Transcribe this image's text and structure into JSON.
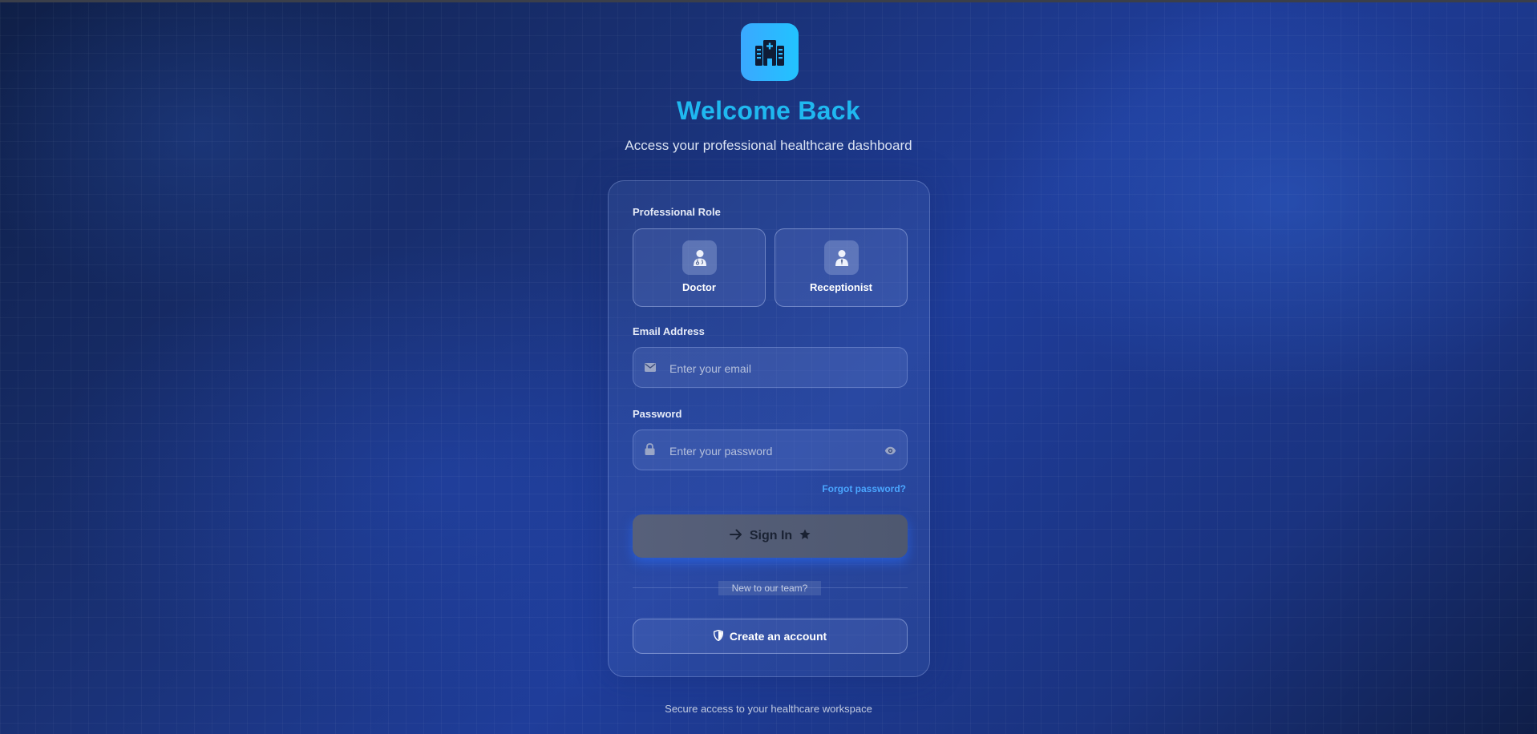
{
  "header": {
    "logo_icon": "hospital-icon",
    "title": "Welcome Back",
    "subtitle": "Access your professional healthcare dashboard"
  },
  "form": {
    "role_label": "Professional Role",
    "roles": [
      {
        "label": "Doctor",
        "icon": "doctor-icon"
      },
      {
        "label": "Receptionist",
        "icon": "receptionist-icon"
      }
    ],
    "email": {
      "label": "Email Address",
      "placeholder": "Enter your email",
      "value": "",
      "icon": "envelope-icon"
    },
    "password": {
      "label": "Password",
      "placeholder": "Enter your password",
      "value": "",
      "icon": "lock-icon",
      "toggle_icon": "eye-icon"
    },
    "forgot_password": "Forgot password?",
    "sign_in": {
      "label": "Sign In",
      "icons": [
        "arrow-right-icon",
        "star-icon"
      ]
    },
    "divider_text": "New to our team?",
    "create_account": {
      "label": "Create an account",
      "icon": "shield-icon"
    }
  },
  "footer": {
    "text": "Secure access to your healthcare workspace"
  },
  "colors": {
    "accent": "#1fb8f0",
    "link": "#4aa6ff",
    "logo_gradient": [
      "#3aa8ff",
      "#22c3ff"
    ]
  }
}
